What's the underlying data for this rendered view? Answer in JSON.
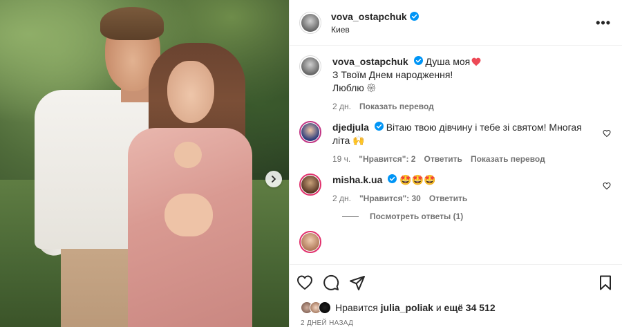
{
  "post": {
    "author": "vova_ostapchuk",
    "location": "Киев",
    "more_icon": "•••"
  },
  "caption": {
    "author": "vova_ostapchuk",
    "line1": "Душа моя",
    "line2": "З Твоїм Днем народження!",
    "line3": "Люблю 𑁍",
    "time": "2 дн.",
    "translate": "Показать перевод"
  },
  "comments": [
    {
      "author": "djedjula",
      "text": "Вітаю твою дівчину і тебе зі святом! Многая літа 🙌",
      "time": "19 ч.",
      "likes": "\"Нравится\": 2",
      "reply": "Ответить",
      "translate": "Показать перевод"
    },
    {
      "author": "misha.k.ua",
      "text": "🤩🤩🤩",
      "time": "2 дн.",
      "likes": "\"Нравится\": 30",
      "reply": "Ответить"
    }
  ],
  "view_replies": "Посмотреть ответы (1)",
  "likes_bar": {
    "prefix": "Нравится",
    "user": "julia_poliak",
    "middle": "и",
    "rest": "ещё 34 512"
  },
  "posted_ago": "2 ДНЕЙ НАЗАД",
  "colors": {
    "verified": "#0095f6",
    "heart": "#ed4956"
  }
}
